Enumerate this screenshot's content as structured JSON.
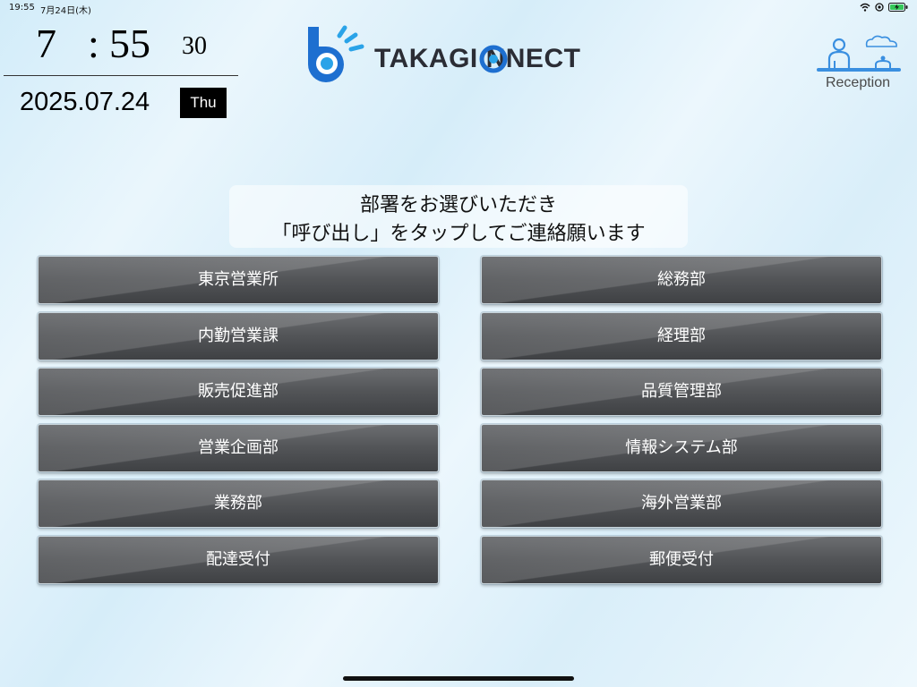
{
  "status_bar": {
    "time": "19:55",
    "date": "7月24日(木)",
    "icons": [
      "wifi-icon",
      "focus-icon",
      "battery-charging-icon"
    ]
  },
  "clock": {
    "hour": "7",
    "separator": ":",
    "minute": "55",
    "second": "30",
    "date": "2025.07.24",
    "weekday": "Thu"
  },
  "logo": {
    "text": "TAKAGI   NNECT",
    "brand_colors": [
      "#1e6fd0",
      "#2aa3e8"
    ]
  },
  "reception": {
    "label": "Reception",
    "icon": "reception-desk-icon",
    "accent": "#3a8fe0"
  },
  "instruction": {
    "line1": "部署をお選びいただき",
    "line2": "「呼び出し」をタップしてご連絡願います"
  },
  "departments": [
    "東京営業所",
    "総務部",
    "内勤営業課",
    "経理部",
    "販売促進部",
    "品質管理部",
    "営業企画部",
    "情報システム部",
    "業務部",
    "海外営業部",
    "配達受付",
    "郵便受付"
  ]
}
